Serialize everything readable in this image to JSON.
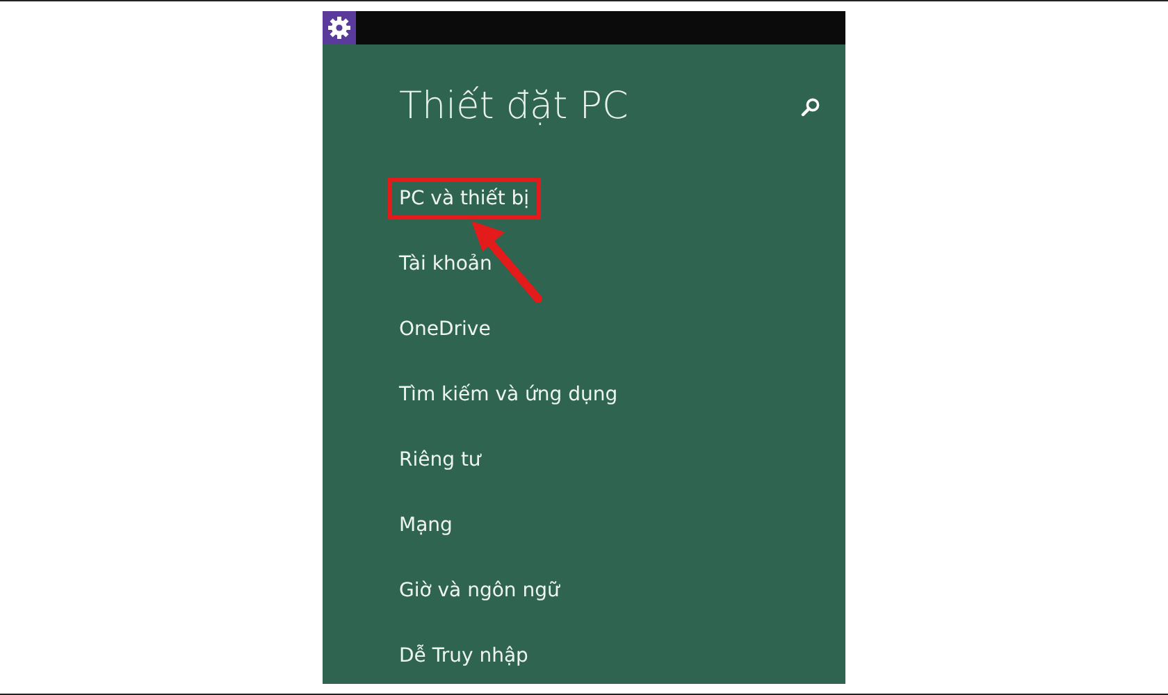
{
  "title": "Thiết đặt PC",
  "items": [
    {
      "label": "PC và thiết bị",
      "highlighted": true
    },
    {
      "label": "Tài khoản",
      "highlighted": false
    },
    {
      "label": "OneDrive",
      "highlighted": false
    },
    {
      "label": "Tìm kiếm và ứng dụng",
      "highlighted": false
    },
    {
      "label": "Riêng tư",
      "highlighted": false
    },
    {
      "label": "Mạng",
      "highlighted": false
    },
    {
      "label": "Giờ và ngôn ngữ",
      "highlighted": false
    },
    {
      "label": "Dễ Truy nhập",
      "highlighted": false
    }
  ]
}
